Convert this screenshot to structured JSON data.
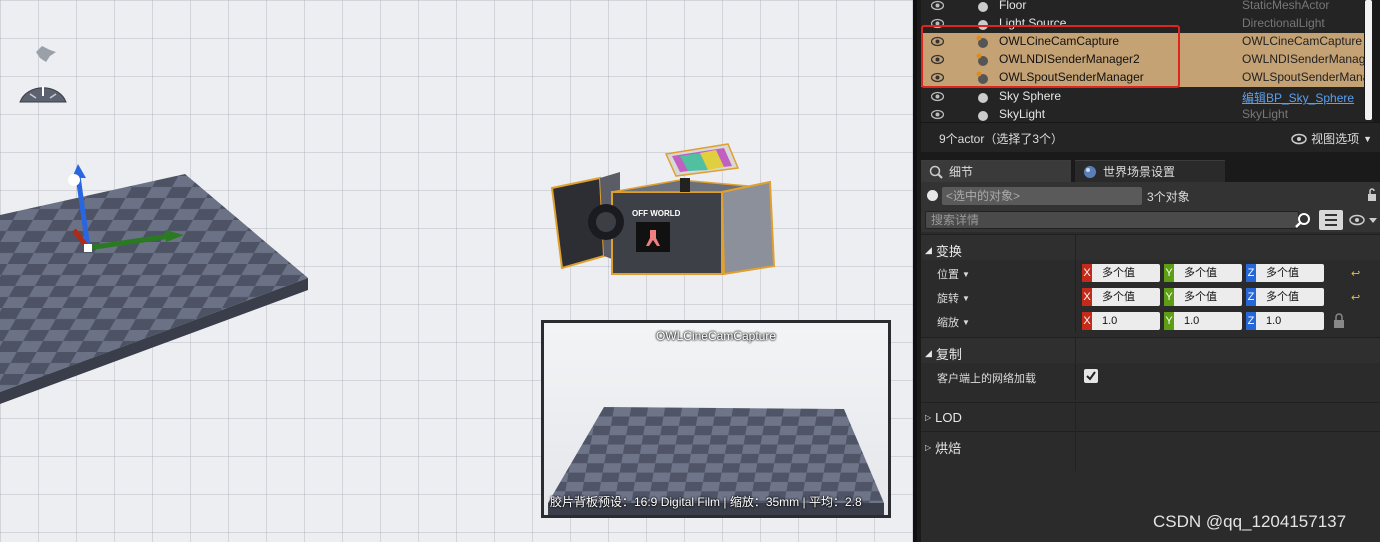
{
  "viewport": {
    "camera_label": "OFF WORLD",
    "preview": {
      "title": "OWLCineCamCapture",
      "footer": "胶片背板预设：16:9 Digital Film | 缩放：35mm | 平均：2.8"
    }
  },
  "outliner": {
    "rows": [
      {
        "name": "Floor",
        "type": "StaticMeshActor",
        "selected": false,
        "icon": "static-mesh-icon"
      },
      {
        "name": "Light Source",
        "type": "DirectionalLight",
        "selected": false,
        "icon": "light-icon"
      },
      {
        "name": "OWLCineCamCapture",
        "type": "OWLCineCamCapture",
        "selected": true,
        "icon": "camera-actor-icon"
      },
      {
        "name": "OWLNDISenderManager2",
        "type": "OWLNDISenderManager",
        "selected": true,
        "icon": "ndi-icon"
      },
      {
        "name": "OWLSpoutSenderManager",
        "type": "OWLSpoutSenderManager",
        "selected": true,
        "icon": "spout-icon"
      },
      {
        "name": "Sky Sphere",
        "type": "编辑BP_Sky_Sphere",
        "selected": false,
        "icon": "sphere-icon",
        "link": true
      },
      {
        "name": "SkyLight",
        "type": "SkyLight",
        "selected": false,
        "icon": "skylight-icon"
      }
    ],
    "status": "9个actor（选择了3个）",
    "view_options": "视图选项"
  },
  "tabs": {
    "details": "细节",
    "world_settings": "世界场景设置"
  },
  "details": {
    "selected_placeholder": "<选中的对象>",
    "object_count": "3个对象",
    "search_placeholder": "搜索详情",
    "categories": {
      "transform": "变换",
      "replication": "复制",
      "lod": "LOD",
      "baking": "烘焙"
    },
    "transform": {
      "location": {
        "label": "位置",
        "x": "多个值",
        "y": "多个值",
        "z": "多个值"
      },
      "rotation": {
        "label": "旋转",
        "x": "多个值",
        "y": "多个值",
        "z": "多个值"
      },
      "scale": {
        "label": "缩放",
        "x": "1.0",
        "y": "1.0",
        "z": "1.0"
      }
    },
    "replication": {
      "net_load_label": "客户端上的网络加载",
      "net_load_checked": true
    },
    "axis": {
      "x": "X",
      "y": "Y",
      "z": "Z"
    }
  },
  "watermark": "CSDN @qq_1204157137",
  "colors": {
    "selection": "#c4a274",
    "highlight_box": "#e0241e",
    "axis_x": "#c42a1a",
    "axis_y": "#5d9e14",
    "axis_z": "#2567d8"
  }
}
